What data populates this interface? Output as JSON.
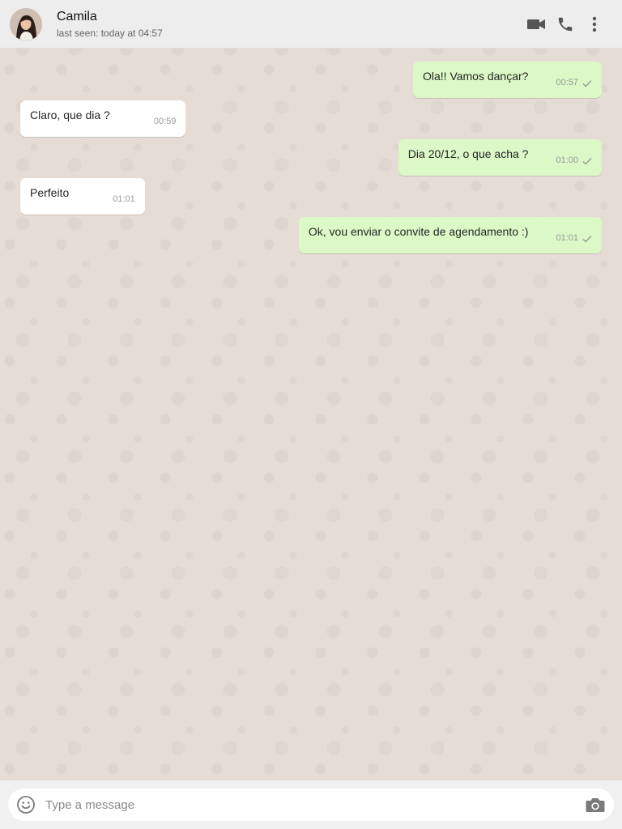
{
  "header": {
    "contact_name": "Camila",
    "status": "last seen: today at 04:57",
    "icons": [
      "avatar",
      "video-call-icon",
      "phone-icon",
      "more-vert-icon"
    ]
  },
  "messages": [
    {
      "direction": "out",
      "text": "Ola!! Vamos dançar?",
      "time": "00:57",
      "status": "sent"
    },
    {
      "direction": "in",
      "text": "Claro, que dia ?",
      "time": "00:59"
    },
    {
      "direction": "out",
      "text": "Dia 20/12, o que acha ?",
      "time": "01:00",
      "status": "sent"
    },
    {
      "direction": "in",
      "text": "Perfeito",
      "time": "01:01"
    },
    {
      "direction": "out",
      "text": "Ok, vou enviar o convite de agendamento :)",
      "time": "01:01",
      "status": "sent"
    }
  ],
  "composer": {
    "placeholder": "Type a message",
    "icons": [
      "emoji-icon",
      "camera-icon"
    ]
  },
  "colors": {
    "background": "#e5ddd5",
    "header": "#ededed",
    "outgoing_bubble": "#dcf8c6",
    "incoming_bubble": "#ffffff"
  }
}
